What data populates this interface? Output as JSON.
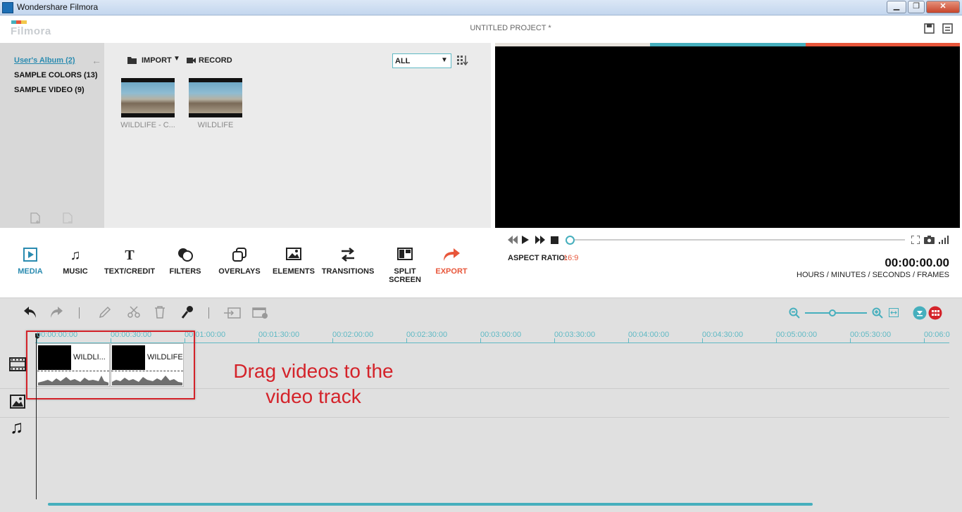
{
  "window": {
    "title": "Wondershare Filmora",
    "min_label": "▁",
    "max_label": "❐",
    "close_label": "✕"
  },
  "header": {
    "logo": "Filmora",
    "project_title": "UNTITLED PROJECT *"
  },
  "library": {
    "albums": [
      {
        "label": "User's Album (2)"
      },
      {
        "label": "SAMPLE COLORS (13)"
      },
      {
        "label": "SAMPLE VIDEO (9)"
      }
    ],
    "import_label": "IMPORT",
    "record_label": "RECORD",
    "filter_value": "ALL",
    "media": [
      {
        "label": "WILDLIFE - C..."
      },
      {
        "label": "WILDLIFE"
      }
    ]
  },
  "player": {
    "aspect_label": "ASPECT RATIO:",
    "aspect_value": "16:9",
    "timecode": "00:00:00.00",
    "timecode_caption": "HOURS / MINUTES / SECONDS / FRAMES",
    "progress": 0
  },
  "tools": [
    {
      "label": "MEDIA",
      "icon": "media-icon"
    },
    {
      "label": "MUSIC",
      "icon": "music-icon"
    },
    {
      "label": "TEXT/CREDIT",
      "icon": "text-icon"
    },
    {
      "label": "FILTERS",
      "icon": "filters-icon"
    },
    {
      "label": "OVERLAYS",
      "icon": "overlays-icon"
    },
    {
      "label": "ELEMENTS",
      "icon": "elements-icon"
    },
    {
      "label": "TRANSITIONS",
      "icon": "transitions-icon"
    },
    {
      "label": "SPLIT SCREEN",
      "icon": "split-screen-icon"
    },
    {
      "label": "EXPORT",
      "icon": "export-icon"
    }
  ],
  "timeline": {
    "ticks": [
      "00:00:00:00",
      "00:00:30:00",
      "00:01:00:00",
      "00:01:30:00",
      "00:02:00:00",
      "00:02:30:00",
      "00:03:00:00",
      "00:03:30:00",
      "00:04:00:00",
      "00:04:30:00",
      "00:05:00:00",
      "00:05:30:00",
      "00:06:0"
    ],
    "clips": [
      {
        "label": "WILDLI..."
      },
      {
        "label": "WILDLIFE"
      }
    ],
    "hint": "Drag videos to the video track"
  },
  "colors": {
    "accent": "#46afbd",
    "export": "#e8563a",
    "hint": "#d4232a"
  }
}
